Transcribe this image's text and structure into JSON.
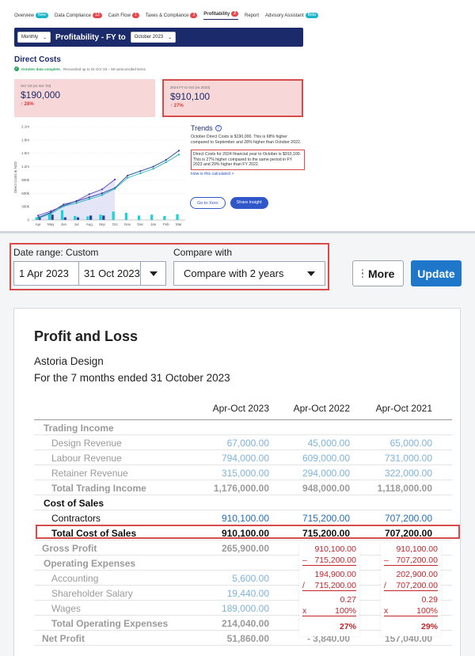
{
  "tabs": [
    {
      "label": "Overview",
      "badge": "New",
      "badge_color": "#19b5c9"
    },
    {
      "label": "Data Compliance",
      "badge": "13",
      "badge_color": "#e5484d"
    },
    {
      "label": "Cash Flow",
      "badge": "1",
      "badge_color": "#e5484d"
    },
    {
      "label": "Taxes & Compliance",
      "badge": "3",
      "badge_color": "#e5484d"
    },
    {
      "label": "Profitability",
      "badge": "2",
      "badge_color": "#e5484d"
    },
    {
      "label": "Report",
      "badge": "",
      "badge_color": ""
    },
    {
      "label": "Advisory Assistant",
      "badge": "Beta",
      "badge_color": "#19b5c9"
    }
  ],
  "navbar": {
    "period_select": "Monthly",
    "title": "Profitability - FY to",
    "month_select": "October 2023"
  },
  "direct_costs": {
    "title": "Direct Costs",
    "note_ok": "October data complete.",
    "note_rest": "Reconciled up to 31 Oct '23 – 59 unreconciled items",
    "card1": {
      "label": "Oct '23 (vs Oct '23)",
      "value": "$190,000",
      "pct": "↑ 28%"
    },
    "card2": {
      "label": "2024 FY to Oct (vs 2023)",
      "value": "$910,100",
      "pct": "↑ 27%"
    }
  },
  "trends": {
    "title": "Trends",
    "p1": "October Direct Costs is $190,000. This is 68% higher compared to September and 28% higher than October 2022.",
    "p2": "Direct Costs for 2024 financial year to October is $910,100. This is 27% higher compared to the same period in FY 2023 and 29% higher than FY 2022.",
    "link": "How is this calculated  >",
    "btn_xero": "Go to Xero",
    "btn_share": "Share insight"
  },
  "chart_data": {
    "type": "bar",
    "ylabel": "Direct Costs in NZD",
    "y_ticks": [
      "2.1m",
      "1.8m",
      "1.5m",
      "1.2m",
      "900k",
      "600k",
      "300k",
      "0"
    ],
    "ylim": [
      0,
      2100000
    ],
    "categories": [
      "Apr",
      "May",
      "Jun",
      "Jul",
      "Aug",
      "Sep",
      "Oct",
      "Nov",
      "Dec",
      "Jan",
      "Feb",
      "Mar"
    ],
    "series": [
      {
        "name": "",
        "kind": "bar",
        "color": "#19d3d8",
        "values": [
          60000,
          150000,
          220000,
          90000,
          80000,
          120000,
          190000,
          160000,
          100000,
          120000,
          90000,
          130000
        ]
      },
      {
        "name": "",
        "kind": "bar",
        "color": "#2c3e9a",
        "values": [
          80000,
          120000,
          60000,
          60000,
          100000,
          100000,
          null,
          null,
          null,
          null,
          null,
          null
        ]
      },
      {
        "name": "",
        "kind": "line",
        "color": "#5b3fc4",
        "values": [
          100000,
          200000,
          320000,
          430000,
          580000,
          690000,
          910000,
          null,
          null,
          null,
          null,
          null
        ]
      },
      {
        "name": "",
        "kind": "line",
        "color": "#2c3e9a",
        "values": [
          50000,
          170000,
          350000,
          420000,
          510000,
          600000,
          720000,
          1000000,
          1100000,
          1200000,
          1350000,
          1560000
        ]
      },
      {
        "name": "",
        "kind": "line",
        "color": "#19b5b5",
        "values": [
          40000,
          140000,
          310000,
          380000,
          470000,
          560000,
          700000,
          950000,
          1050000,
          1150000,
          1300000,
          1470000
        ]
      }
    ]
  },
  "controls": {
    "date_range_label": "Date range: Custom",
    "date_from": "1 Apr 2023",
    "date_to": "31 Oct 2023",
    "compare_label": "Compare with",
    "compare_value": "Compare with 2 years",
    "more_label": "More",
    "update_label": "Update"
  },
  "report": {
    "title": "Profit and Loss",
    "company": "Astoria Design",
    "period": "For the 7 months ended 31 October 2023",
    "columns": [
      "Apr-Oct 2023",
      "Apr-Oct 2022",
      "Apr-Oct 2021"
    ],
    "rows": [
      {
        "label": "Trading Income",
        "values": [
          "",
          "",
          ""
        ]
      },
      {
        "label": "Design Revenue",
        "values": [
          "67,000.00",
          "45,000.00",
          "65,000.00"
        ]
      },
      {
        "label": "Labour Revenue",
        "values": [
          "794,000.00",
          "609,000.00",
          "731,000.00"
        ]
      },
      {
        "label": "Retainer Revenue",
        "values": [
          "315,000.00",
          "294,000.00",
          "322,000.00"
        ]
      },
      {
        "label": "Total Trading Income",
        "values": [
          "1,176,000.00",
          "948,000.00",
          "1,118,000.00"
        ]
      },
      {
        "label": "Cost of Sales",
        "values": [
          "",
          "",
          ""
        ]
      },
      {
        "label": "Contractors",
        "values": [
          "910,100.00",
          "715,200.00",
          "707,200.00"
        ]
      },
      {
        "label": "Total Cost of Sales",
        "values": [
          "910,100.00",
          "715,200.00",
          "707,200.00"
        ]
      },
      {
        "label": "Gross Profit",
        "values": [
          "265,900.00",
          "",
          ""
        ]
      },
      {
        "label": "Operating Expenses",
        "values": [
          "",
          "",
          ""
        ]
      },
      {
        "label": "Accounting",
        "values": [
          "5,600.00",
          "",
          ""
        ]
      },
      {
        "label": "Shareholder Salary",
        "values": [
          "19,440.00",
          "",
          ""
        ]
      },
      {
        "label": "Wages",
        "values": [
          "189,000.00",
          "",
          ""
        ]
      },
      {
        "label": "Total Operating Expenses",
        "values": [
          "214,040.00",
          "",
          ""
        ]
      },
      {
        "label": "Net Profit",
        "values": [
          "51,860.00",
          "- 3,840.00",
          "157,040.00"
        ]
      }
    ]
  },
  "calcs": [
    {
      "a": "910,100.00",
      "b_op": "–",
      "b": "715,200.00",
      "diff": "194,900.00",
      "div_op": "/",
      "div": "715,200.00",
      "ratio": "0.27",
      "mul_op": "x",
      "mul": "100%",
      "result": "27%"
    },
    {
      "a": "910,100.00",
      "b_op": "–",
      "b": "707,200.00",
      "diff": "202,900.00",
      "div_op": "/",
      "div": "707,200.00",
      "ratio": "0.29",
      "mul_op": "x",
      "mul": "100%",
      "result": "29%"
    }
  ]
}
